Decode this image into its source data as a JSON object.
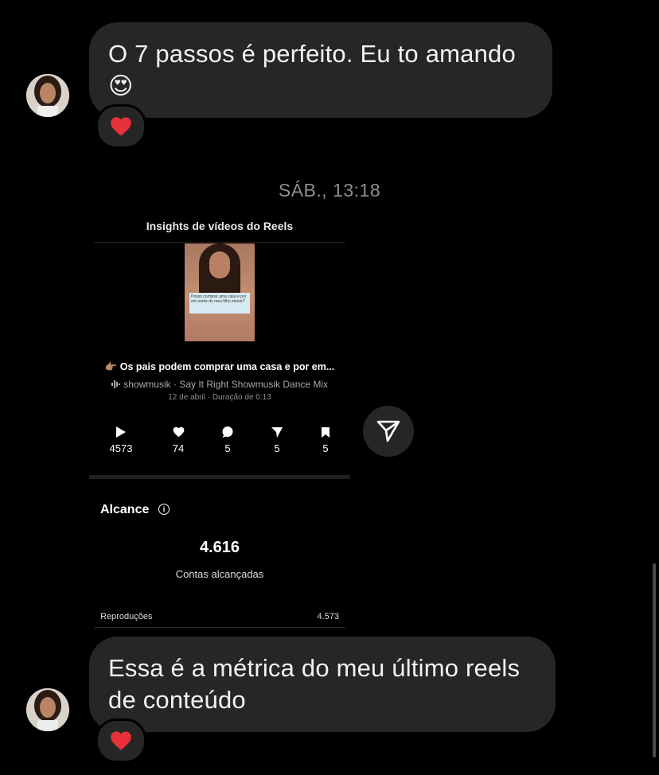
{
  "messages": [
    {
      "text": "O 7 passos é perfeito. Eu to amando",
      "emoji": "😍",
      "reaction": "heart"
    },
    {
      "text": "Essa é a métrica do meu último reels de conteúdo",
      "reaction": "heart"
    }
  ],
  "timestamp": "SÁB., 13:18",
  "shared_post": {
    "header": "Insights de vídeos do Reels",
    "thumb_caption": "Posso comprar uma casa e por em nome do meu filho menor?",
    "title": "👉🏽 Os pais podem comprar uma casa e por em...",
    "music": "showmusik · Say It Right Showmusik Dance Mix",
    "date": "12 de abril · Duração de 0:13",
    "stats": [
      {
        "icon": "play-icon",
        "value": "4573"
      },
      {
        "icon": "heart-icon",
        "value": "74"
      },
      {
        "icon": "comment-icon",
        "value": "5"
      },
      {
        "icon": "send-icon",
        "value": "5"
      },
      {
        "icon": "bookmark-icon",
        "value": "5"
      }
    ],
    "reach": {
      "title": "Alcance",
      "value": "4.616",
      "label": "Contas alcançadas",
      "plays_label": "Reproduções",
      "plays_value": "4.573"
    }
  },
  "colors": {
    "bubble": "#262626",
    "background": "#000000",
    "timestamp": "#8e8e8e",
    "reaction_heart": "#e8303a"
  }
}
